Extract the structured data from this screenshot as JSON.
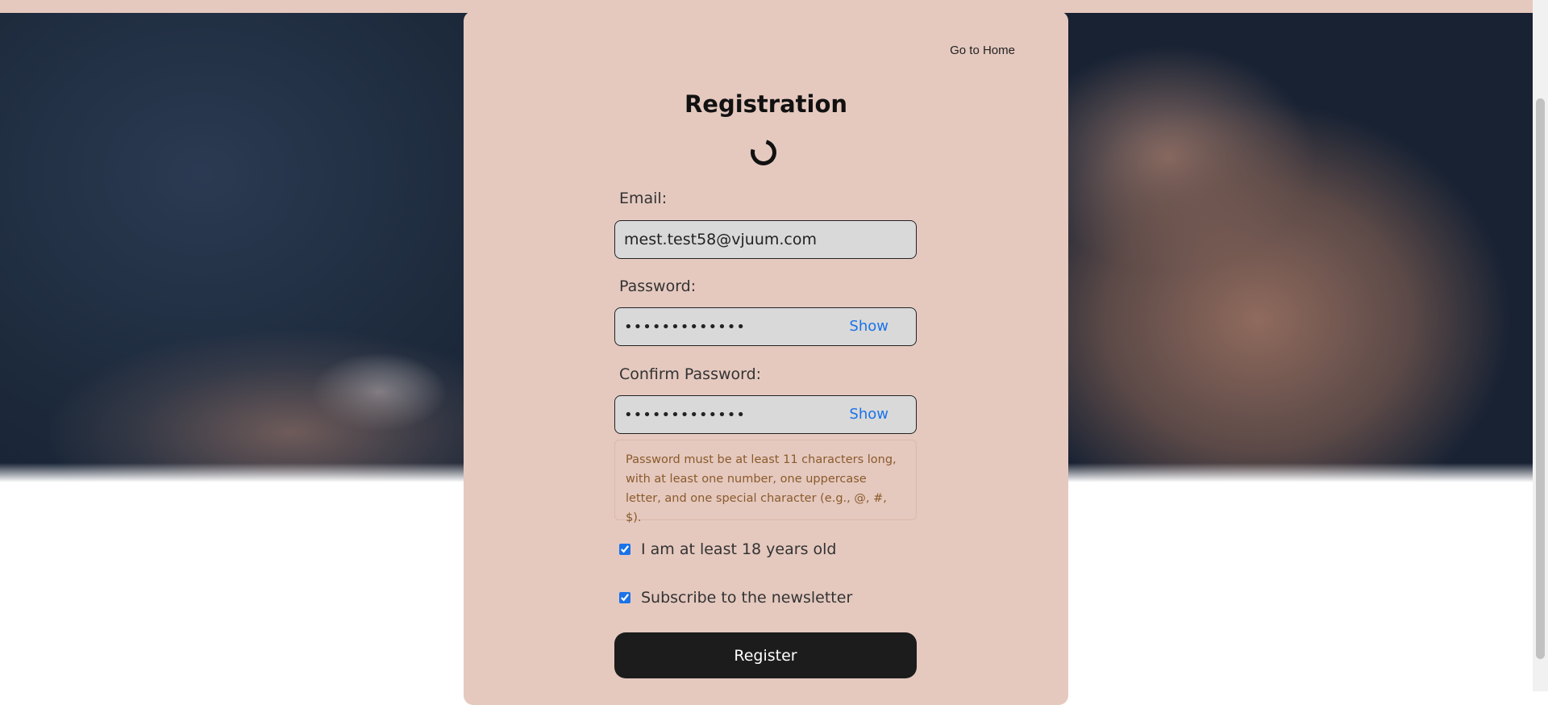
{
  "header": {
    "home_link": "Go to Home"
  },
  "form": {
    "title": "Registration",
    "email": {
      "label": "Email:",
      "value": "mest.test58@vjuum.com"
    },
    "password": {
      "label": "Password:",
      "value": "•••••••••••••",
      "show_label": "Show"
    },
    "confirm_password": {
      "label": "Confirm Password:",
      "value": "•••••••••••••",
      "show_label": "Show"
    },
    "hint": "Password must be at least 11 characters long, with at least one number, one uppercase letter, and one special character (e.g., @, #, $).",
    "age_checkbox": {
      "label": "I am at least 18 years old",
      "checked": true
    },
    "newsletter_checkbox": {
      "label": "Subscribe to the newsletter",
      "checked": true
    },
    "submit_label": "Register"
  },
  "icons": {
    "loading": "loading-spinner-icon"
  },
  "colors": {
    "card": "#e5c9bf",
    "accent_link": "#1a73e8",
    "button": "#1c1c1c",
    "hint_text": "#8a5a2b"
  }
}
